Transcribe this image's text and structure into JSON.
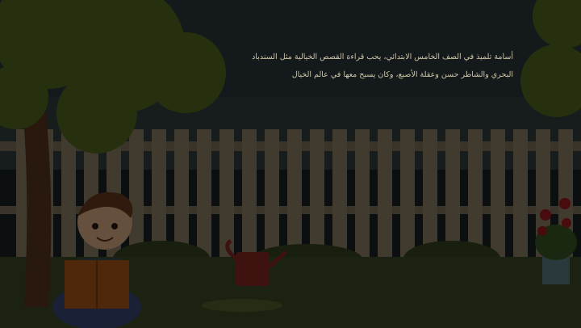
{
  "story": {
    "line1": "أسامة تلميذ في الصف الخامس الابتدائي، يحب قراءة القصص الخيالية مثل السندباد",
    "line2": "البحري والشاطر حسن وعقلة الأصبع، وكان يسبح معها في عالم الخيال"
  },
  "colors": {
    "sky": "#2a3438",
    "fence": "#8a7a62",
    "grass": "#3d4a26",
    "foliage": "#556a22",
    "watering_can": "#8a2a22",
    "book": "#b05a1c",
    "flowers": "#a11c20"
  }
}
